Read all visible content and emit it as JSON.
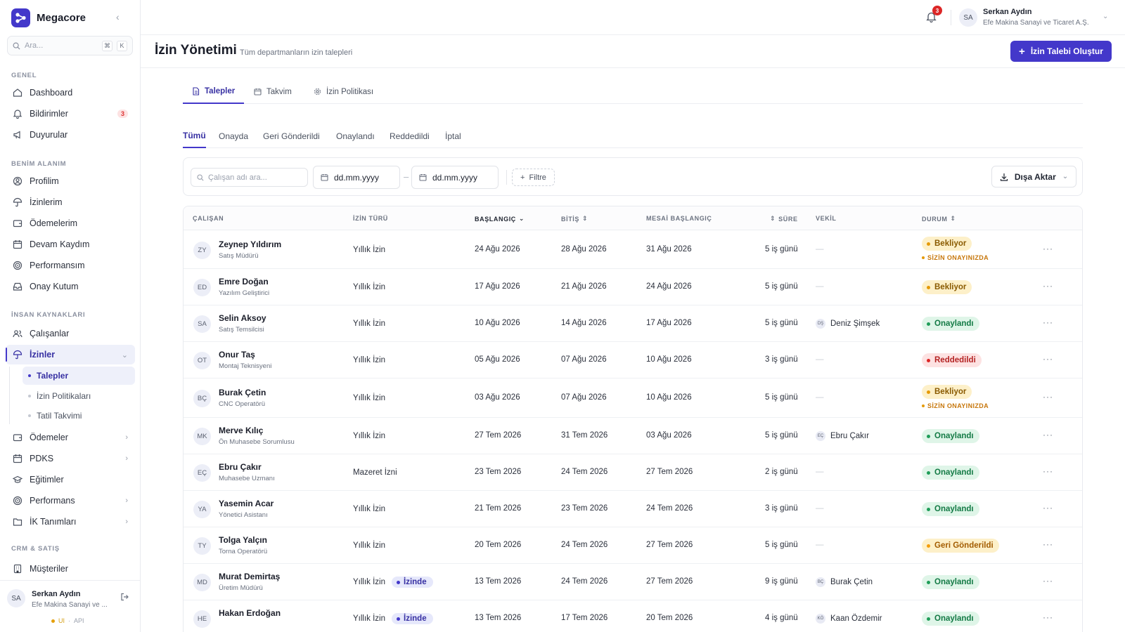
{
  "app": {
    "name": "Megacore"
  },
  "sidebar": {
    "search_placeholder": "Ara...",
    "shortcut": [
      "⌘",
      "K"
    ],
    "sections": {
      "genel": "GENEL",
      "benim": "BENİM ALANIM",
      "ik": "İNSAN KAYNAKLARI",
      "crm": "CRM & SATIŞ"
    },
    "genel_items": [
      {
        "label": "Dashboard",
        "icon": "home-icon"
      },
      {
        "label": "Bildirimler",
        "icon": "bell-icon",
        "badge": "3"
      },
      {
        "label": "Duyurular",
        "icon": "megaphone-icon"
      }
    ],
    "benim_items": [
      {
        "label": "Profilim",
        "icon": "user-circle-icon"
      },
      {
        "label": "İzinlerim",
        "icon": "umbrella-icon"
      },
      {
        "label": "Ödemelerim",
        "icon": "wallet-icon"
      },
      {
        "label": "Devam Kaydım",
        "icon": "calendar-icon"
      },
      {
        "label": "Performansım",
        "icon": "target-icon"
      },
      {
        "label": "Onay Kutum",
        "icon": "inbox-icon"
      }
    ],
    "ik_items": [
      {
        "label": "Çalışanlar",
        "icon": "users-icon"
      },
      {
        "label": "İzinler",
        "icon": "umbrella-icon"
      },
      {
        "label": "Ödemeler",
        "icon": "wallet-icon"
      },
      {
        "label": "PDKS",
        "icon": "calendar-icon"
      },
      {
        "label": "Eğitimler",
        "icon": "graduation-cap-icon"
      },
      {
        "label": "Performans",
        "icon": "target-icon"
      },
      {
        "label": "İK Tanımları",
        "icon": "folder-icon"
      }
    ],
    "izin_sub": [
      "Talepler",
      "İzin Politikaları",
      "Tatil Takvimi"
    ],
    "crm_items": [
      {
        "label": "Müşteriler",
        "icon": "building-icon"
      }
    ],
    "user": {
      "initials": "SA",
      "name": "Serkan Aydın",
      "company": "Efe Makina Sanayi ve ...",
      "env_ui": "UI",
      "env_sep": "·",
      "env_api": "API"
    }
  },
  "topbar": {
    "notif_count": "3",
    "user_initials": "SA",
    "user_name": "Serkan Aydın",
    "user_company": "Efe Makina Sanayi ve Ticaret A.Ş."
  },
  "page": {
    "title": "İzin Yönetimi",
    "subtitle": "Tüm departmanların izin talepleri",
    "create_button": "İzin Talebi Oluştur"
  },
  "tabs": [
    "Talepler",
    "Takvim",
    "İzin Politikası"
  ],
  "filter_tabs": [
    "Tümü",
    "Onayda",
    "Geri Gönderildi",
    "Onaylandı",
    "Reddedildi",
    "İptal"
  ],
  "filters": {
    "search_placeholder": "Çalışan adı ara...",
    "date_placeholder": "dd.mm.yyyy",
    "range_sep": "–",
    "filter_label": "Filtre",
    "export_label": "Dışa Aktar"
  },
  "table": {
    "headers": [
      "ÇALIŞAN",
      "İZİN TÜRÜ",
      "BAŞLANGIÇ",
      "BİTİŞ",
      "MESAİ BAŞLANGIÇ",
      "SÜRE",
      "VEKİL",
      "DURUM"
    ],
    "await_label": "SİZİN ONAYINIZDA",
    "on_leave_label": "İzinde",
    "rows": [
      {
        "initials": "ZY",
        "name": "Zeynep Yıldırım",
        "role": "Satış Müdürü",
        "type": "Yıllık İzin",
        "start": "24 Ağu 2026",
        "end": "28 Ağu 2026",
        "work_start": "31 Ağu 2026",
        "duration": "5 iş günü",
        "proxy": "—",
        "proxy_initials": "",
        "status": "Bekliyor",
        "status_kind": "pending",
        "awaiting": true,
        "on_leave": false
      },
      {
        "initials": "ED",
        "name": "Emre Doğan",
        "role": "Yazılım Geliştirici",
        "type": "Yıllık İzin",
        "start": "17 Ağu 2026",
        "end": "21 Ağu 2026",
        "work_start": "24 Ağu 2026",
        "duration": "5 iş günü",
        "proxy": "—",
        "proxy_initials": "",
        "status": "Bekliyor",
        "status_kind": "pending",
        "awaiting": false,
        "on_leave": false
      },
      {
        "initials": "SA",
        "name": "Selin Aksoy",
        "role": "Satış Temsilcisi",
        "type": "Yıllık İzin",
        "start": "10 Ağu 2026",
        "end": "14 Ağu 2026",
        "work_start": "17 Ağu 2026",
        "duration": "5 iş günü",
        "proxy": "Deniz Şimşek",
        "proxy_initials": "DŞ",
        "status": "Onaylandı",
        "status_kind": "approved",
        "awaiting": false,
        "on_leave": false
      },
      {
        "initials": "OT",
        "name": "Onur Taş",
        "role": "Montaj Teknisyeni",
        "type": "Yıllık İzin",
        "start": "05 Ağu 2026",
        "end": "07 Ağu 2026",
        "work_start": "10 Ağu 2026",
        "duration": "3 iş günü",
        "proxy": "—",
        "proxy_initials": "",
        "status": "Reddedildi",
        "status_kind": "rejected",
        "awaiting": false,
        "on_leave": false
      },
      {
        "initials": "BÇ",
        "name": "Burak Çetin",
        "role": "CNC Operatörü",
        "type": "Yıllık İzin",
        "start": "03 Ağu 2026",
        "end": "07 Ağu 2026",
        "work_start": "10 Ağu 2026",
        "duration": "5 iş günü",
        "proxy": "—",
        "proxy_initials": "",
        "status": "Bekliyor",
        "status_kind": "pending",
        "awaiting": true,
        "on_leave": false
      },
      {
        "initials": "MK",
        "name": "Merve Kılıç",
        "role": "Ön Muhasebe Sorumlusu",
        "type": "Yıllık İzin",
        "start": "27 Tem 2026",
        "end": "31 Tem 2026",
        "work_start": "03 Ağu 2026",
        "duration": "5 iş günü",
        "proxy": "Ebru Çakır",
        "proxy_initials": "EÇ",
        "status": "Onaylandı",
        "status_kind": "approved",
        "awaiting": false,
        "on_leave": false
      },
      {
        "initials": "EÇ",
        "name": "Ebru Çakır",
        "role": "Muhasebe Uzmanı",
        "type": "Mazeret İzni",
        "start": "23 Tem 2026",
        "end": "24 Tem 2026",
        "work_start": "27 Tem 2026",
        "duration": "2 iş günü",
        "proxy": "—",
        "proxy_initials": "",
        "status": "Onaylandı",
        "status_kind": "approved",
        "awaiting": false,
        "on_leave": false
      },
      {
        "initials": "YA",
        "name": "Yasemin Acar",
        "role": "Yönetici Asistanı",
        "type": "Yıllık İzin",
        "start": "21 Tem 2026",
        "end": "23 Tem 2026",
        "work_start": "24 Tem 2026",
        "duration": "3 iş günü",
        "proxy": "—",
        "proxy_initials": "",
        "status": "Onaylandı",
        "status_kind": "approved",
        "awaiting": false,
        "on_leave": false
      },
      {
        "initials": "TY",
        "name": "Tolga Yalçın",
        "role": "Torna Operatörü",
        "type": "Yıllık İzin",
        "start": "20 Tem 2026",
        "end": "24 Tem 2026",
        "work_start": "27 Tem 2026",
        "duration": "5 iş günü",
        "proxy": "—",
        "proxy_initials": "",
        "status": "Geri Gönderildi",
        "status_kind": "returned",
        "awaiting": false,
        "on_leave": false
      },
      {
        "initials": "MD",
        "name": "Murat Demirtaş",
        "role": "Üretim Müdürü",
        "type": "Yıllık İzin",
        "start": "13 Tem 2026",
        "end": "24 Tem 2026",
        "work_start": "27 Tem 2026",
        "duration": "9 iş günü",
        "proxy": "Burak Çetin",
        "proxy_initials": "BÇ",
        "status": "Onaylandı",
        "status_kind": "approved",
        "awaiting": false,
        "on_leave": true
      },
      {
        "initials": "HE",
        "name": "Hakan Erdoğan",
        "role": "",
        "type": "Yıllık İzin",
        "start": "13 Tem 2026",
        "end": "17 Tem 2026",
        "work_start": "20 Tem 2026",
        "duration": "4 iş günü",
        "proxy": "Kaan Özdemir",
        "proxy_initials": "KÖ",
        "status": "Onaylandı",
        "status_kind": "approved",
        "awaiting": false,
        "on_leave": true
      }
    ]
  },
  "colors": {
    "accent": "#4338ca",
    "pending": "#e59a07",
    "approved": "#1f9d58",
    "rejected": "#dc2626"
  }
}
